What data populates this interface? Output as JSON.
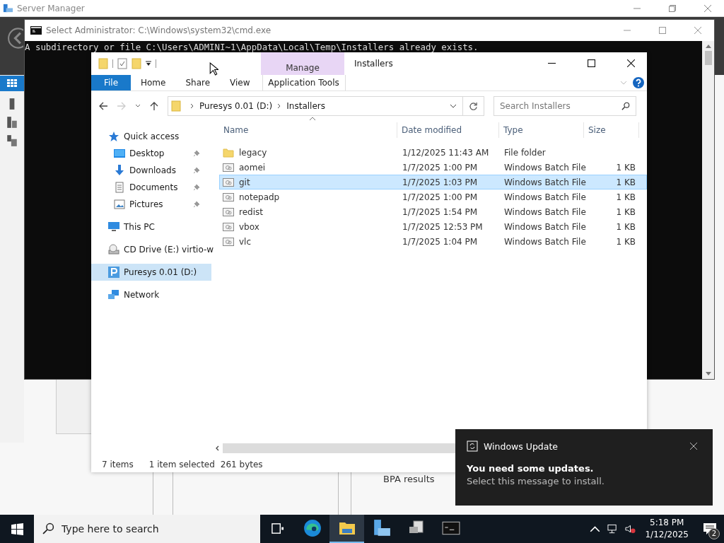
{
  "server_manager": {
    "title": "Server Manager",
    "bpa_label": "BPA results"
  },
  "cmd": {
    "title": "Select Administrator: C:\\Windows\\system32\\cmd.exe",
    "output": "A subdirectory or file C:\\Users\\ADMINI~1\\AppData\\Local\\Temp\\Installers already exists."
  },
  "explorer": {
    "title": "Installers",
    "context_group": "Manage",
    "ribbon_tabs": [
      {
        "label": "File",
        "kind": "file",
        "selected": false
      },
      {
        "label": "Home",
        "kind": "plain",
        "selected": false
      },
      {
        "label": "Share",
        "kind": "plain",
        "selected": false
      },
      {
        "label": "View",
        "kind": "plain",
        "selected": false
      },
      {
        "label": "Application Tools",
        "kind": "context",
        "selected": false
      }
    ],
    "breadcrumb": [
      "Puresys 0.01 (D:)",
      "Installers"
    ],
    "search": {
      "placeholder": "Search Installers"
    },
    "nav": [
      {
        "label": "Quick access",
        "kind": "star",
        "selected": false,
        "pinned": false,
        "children": [
          {
            "label": "Desktop",
            "kind": "desktop",
            "selected": false,
            "pinned": true
          },
          {
            "label": "Downloads",
            "kind": "download",
            "selected": false,
            "pinned": true
          },
          {
            "label": "Documents",
            "kind": "document",
            "selected": false,
            "pinned": true
          },
          {
            "label": "Pictures",
            "kind": "pictures",
            "selected": false,
            "pinned": true
          }
        ]
      },
      {
        "label": "This PC",
        "kind": "pc",
        "selected": false,
        "pinned": false
      },
      {
        "label": "CD Drive (E:) virtio-w",
        "kind": "cd",
        "selected": false,
        "pinned": false
      },
      {
        "label": "Puresys 0.01 (D:)",
        "kind": "drive",
        "selected": true,
        "pinned": false
      },
      {
        "label": "Network",
        "kind": "network",
        "selected": false,
        "pinned": false
      }
    ],
    "columns": [
      "Name",
      "Date modified",
      "Type",
      "Size"
    ],
    "rows": [
      {
        "name": "legacy",
        "date": "1/12/2025 11:43 AM",
        "type": "File folder",
        "size": "",
        "kind": "folder",
        "selected": false
      },
      {
        "name": "aomei",
        "date": "1/7/2025 1:00 PM",
        "type": "Windows Batch File",
        "size": "1 KB",
        "kind": "batch",
        "selected": false
      },
      {
        "name": "git",
        "date": "1/7/2025 1:03 PM",
        "type": "Windows Batch File",
        "size": "1 KB",
        "kind": "batch",
        "selected": true
      },
      {
        "name": "notepadp",
        "date": "1/7/2025 1:00 PM",
        "type": "Windows Batch File",
        "size": "1 KB",
        "kind": "batch",
        "selected": false
      },
      {
        "name": "redist",
        "date": "1/7/2025 1:54 PM",
        "type": "Windows Batch File",
        "size": "1 KB",
        "kind": "batch",
        "selected": false
      },
      {
        "name": "vbox",
        "date": "1/7/2025 12:53 PM",
        "type": "Windows Batch File",
        "size": "1 KB",
        "kind": "batch",
        "selected": false
      },
      {
        "name": "vlc",
        "date": "1/7/2025 1:04 PM",
        "type": "Windows Batch File",
        "size": "1 KB",
        "kind": "batch",
        "selected": false
      }
    ],
    "status": [
      "7 items",
      "1 item selected",
      "261 bytes"
    ]
  },
  "toast": {
    "app": "Windows Update",
    "heading": "You need some updates.",
    "body": "Select this message to install."
  },
  "taskbar": {
    "search_placeholder": "Type here to search",
    "time": "5:18 PM",
    "date": "1/12/2025",
    "notification_count": "2",
    "apps": [
      {
        "kind": "taskview",
        "selected": false
      },
      {
        "kind": "edge",
        "selected": false
      },
      {
        "kind": "explorer",
        "selected": true
      },
      {
        "kind": "servermanager",
        "selected": false
      },
      {
        "kind": "drive",
        "selected": false
      },
      {
        "kind": "cmd",
        "selected": false
      }
    ]
  }
}
